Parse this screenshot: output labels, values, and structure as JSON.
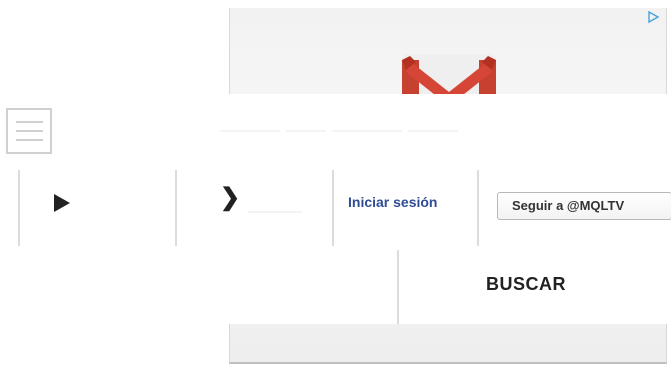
{
  "ad": {
    "logo_icon": "gmail-logo-icon",
    "choices_icon": "ad-choices-icon"
  },
  "header": {
    "menu_icon": "hamburger-menu-icon",
    "play_icon": "play-icon",
    "next_label": "❯",
    "login_label": "Iniciar sesión",
    "follow_label": "Seguir a @MQLTV",
    "search_label": "BUSCAR"
  },
  "colors": {
    "login_link": "#2f4d95",
    "separator": "#dcdcdc",
    "gmail_red": "#d64637"
  }
}
